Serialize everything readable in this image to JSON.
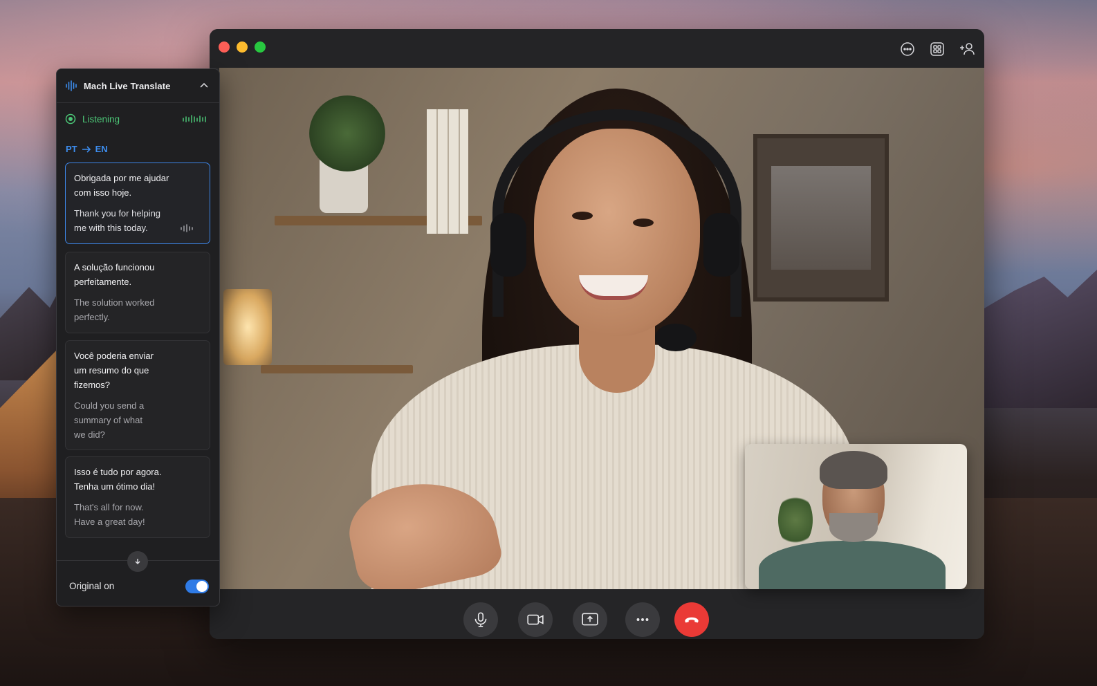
{
  "call_window": {
    "titlebar_icons": [
      "chat-icon",
      "grid-view-icon",
      "add-person-icon"
    ],
    "controls": [
      {
        "name": "mic-button",
        "icon": "microphone-icon"
      },
      {
        "name": "camera-button",
        "icon": "video-camera-icon"
      },
      {
        "name": "share-screen-button",
        "icon": "share-screen-icon"
      },
      {
        "name": "more-button",
        "icon": "ellipsis-icon"
      },
      {
        "name": "end-call-button",
        "icon": "hang-up-icon"
      }
    ],
    "colors": {
      "hangup": "#ea3a36",
      "window_bg": "#2a2a2c"
    }
  },
  "translate_panel": {
    "title": "Mach Live Translate",
    "status": "Listening",
    "source_lang": "PT",
    "target_lang": "EN",
    "cards": [
      {
        "source": "Obrigada por me ajudar\ncom isso hoje.",
        "target": "Thank you for helping\nme with this today.",
        "active": true
      },
      {
        "source": "A solução funcionou\nperfeitamente.",
        "target": "The solution worked\nperfectly.",
        "active": false
      },
      {
        "source": "Você poderia enviar\num resumo do que\nfizemos?",
        "target": "Could you send a\nsummary of what\nwe did?",
        "active": false
      },
      {
        "source": "Isso é tudo por agora.\nTenha um ótimo dia!",
        "target": "That's all for now.\nHave a great day!",
        "active": false
      }
    ],
    "original_toggle_label": "Original on",
    "original_toggle_on": true,
    "colors": {
      "accent": "#3d8ef0",
      "listening": "#4cc777",
      "toggle": "#2f7be6"
    }
  }
}
